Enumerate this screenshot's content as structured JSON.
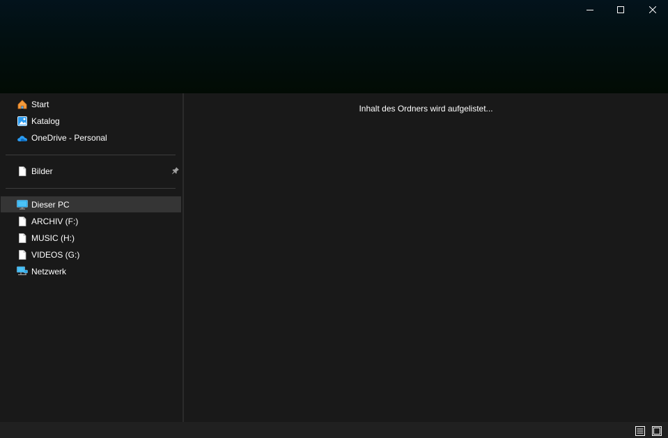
{
  "window": {
    "minimize_label": "Minimieren",
    "maximize_label": "Maximieren",
    "close_label": "Schließen"
  },
  "sidebar": {
    "quick_access": [
      {
        "label": "Start",
        "icon": "home-icon"
      },
      {
        "label": "Katalog",
        "icon": "gallery-icon"
      },
      {
        "label": "OneDrive - Personal",
        "icon": "onedrive-cloud-icon"
      }
    ],
    "pinned": [
      {
        "label": "Bilder",
        "icon": "file-icon",
        "pinned": true
      }
    ],
    "this_pc": [
      {
        "label": "Dieser PC",
        "icon": "monitor-icon",
        "selected": true
      },
      {
        "label": "ARCHIV (F:)",
        "icon": "file-icon"
      },
      {
        "label": "MUSIC (H:)",
        "icon": "file-icon"
      },
      {
        "label": "VIDEOS (G:)",
        "icon": "file-icon"
      },
      {
        "label": "Netzwerk",
        "icon": "network-icon"
      }
    ]
  },
  "content": {
    "status_text": "Inhalt des Ordners wird aufgelistet..."
  },
  "colors": {
    "background": "#191919",
    "selected": "#353535",
    "accent_blue": "#2b9cf2",
    "home_orange": "#f08a24"
  }
}
